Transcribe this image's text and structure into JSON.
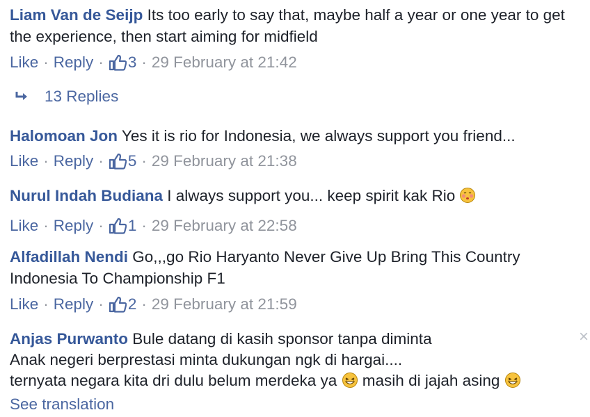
{
  "colors": {
    "author": "#365899",
    "link": "#4b67a1",
    "meta": "#90949c",
    "text": "#1d2129"
  },
  "labels": {
    "like": "Like",
    "reply": "Reply",
    "sep": "·"
  },
  "comments": [
    {
      "author": "Liam Van de Seijp",
      "text": "Its too early to say that, maybe half a year or one year to get the experience, then start aiming for midfield",
      "likes": "3",
      "time": "29 February at 21:42"
    },
    {
      "author": "Halomoan Jon",
      "text": "Yes it is rio for Indonesia, we always support you friend...",
      "likes": "5",
      "time": "29 February at 21:38"
    },
    {
      "author": "Nurul Indah Budiana",
      "text": "I always support you... keep spirit kak Rio",
      "likes": "1",
      "time": "29 February at 22:58"
    },
    {
      "author": "Alfadillah Nendi",
      "text": "Go,,,go Rio Haryanto Never Give Up Bring This Country Indonesia To Championship F1",
      "likes": "2",
      "time": "29 February at 21:59"
    },
    {
      "author": "Anjas Purwanto",
      "line1": "Bule datang di kasih sponsor tanpa diminta",
      "line2": "Anak negeri berprestasi minta dukungan ngk di hargai....",
      "line3a": "ternyata negara kita dri dulu belum merdeka ya",
      "line3b": "masih di jajah asing",
      "see_translation": "See translation"
    }
  ],
  "replies_label": "13 Replies",
  "close_symbol": "×",
  "icons": {
    "like": "thumbs-up-icon",
    "reply_arrow": "reply-arrow-icon",
    "close": "close-icon",
    "emoji_blush": "blush-emoji-icon",
    "emoji_grin": "grin-emoji-icon"
  }
}
